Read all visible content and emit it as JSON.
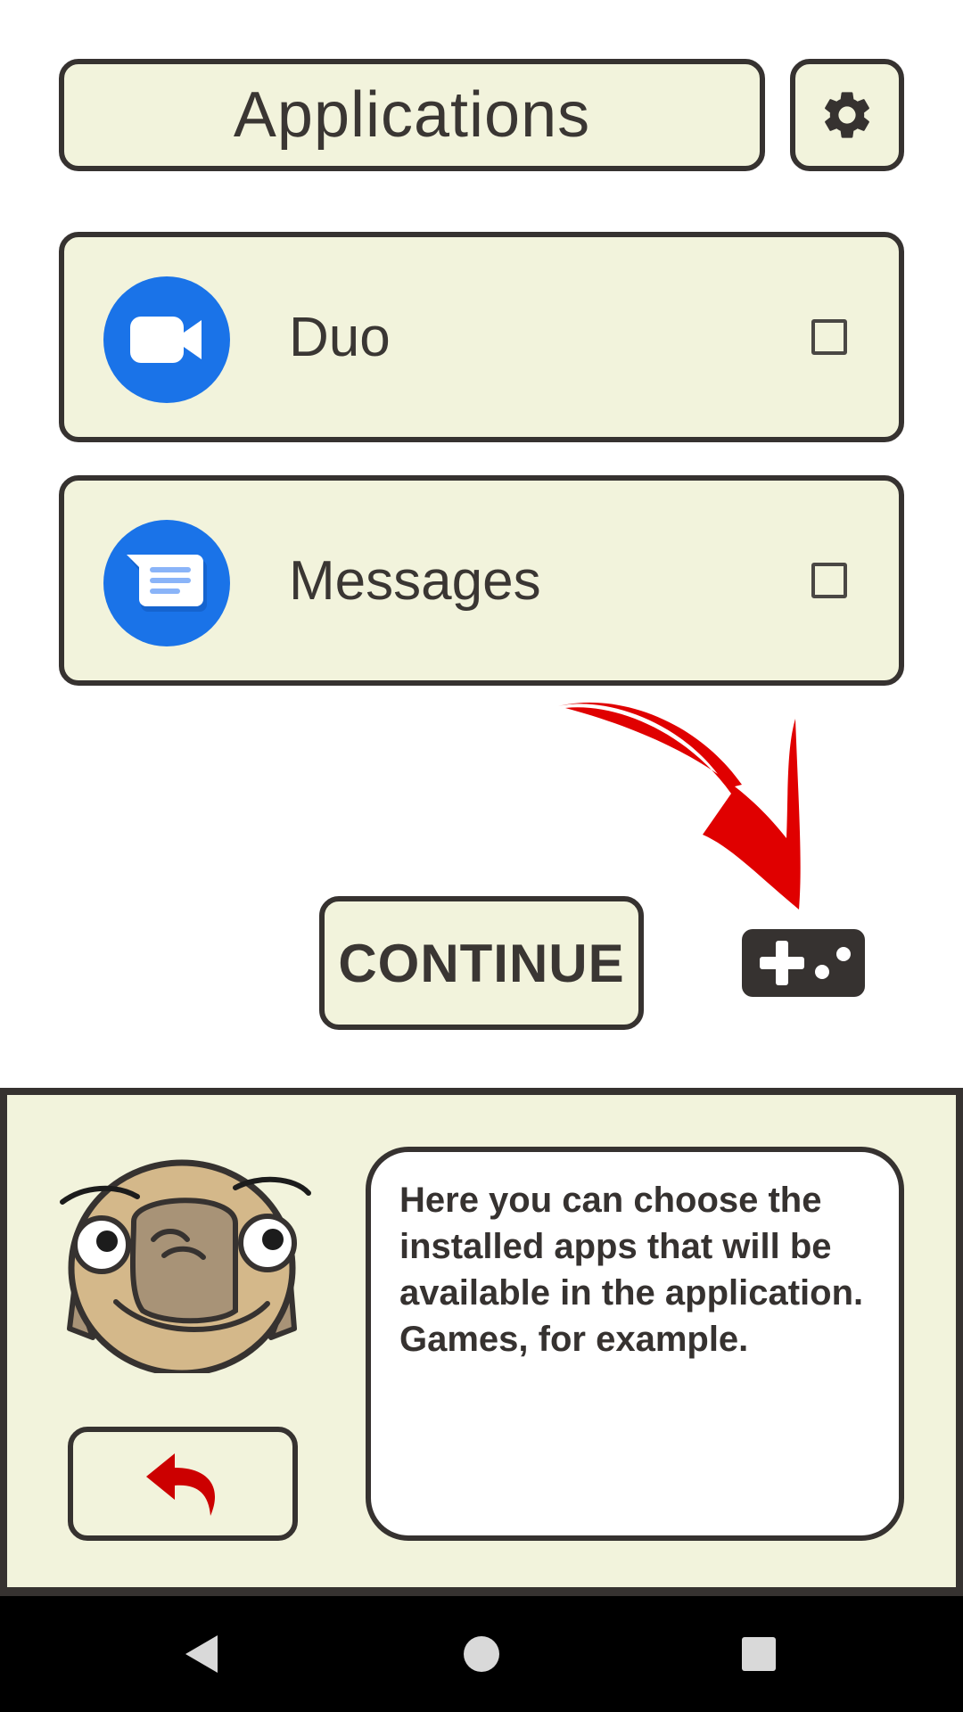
{
  "header": {
    "title": "Applications",
    "settings_icon": "gear-icon"
  },
  "apps": [
    {
      "label": "Duo",
      "icon": "duo-video-icon",
      "checked": false
    },
    {
      "label": "Messages",
      "icon": "messages-chat-icon",
      "checked": false
    }
  ],
  "actions": {
    "continue_label": "CONTINUE",
    "gamepad_icon": "gamepad-icon",
    "arrow_icon": "red-arrow-icon"
  },
  "helper": {
    "message": "Here you can choose the installed apps that will be available in the application. Games, for example.",
    "back_icon": "undo-arrow-icon",
    "mascot": "sloth-mascot"
  },
  "navbar": {
    "back": "nav-back-icon",
    "home": "nav-home-icon",
    "recents": "nav-recents-icon"
  },
  "colors": {
    "panel": "#f2f3dc",
    "border": "#363230",
    "accent_blue": "#1a73e8",
    "arrow_red": "#e00000",
    "back_red": "#cc0000"
  }
}
